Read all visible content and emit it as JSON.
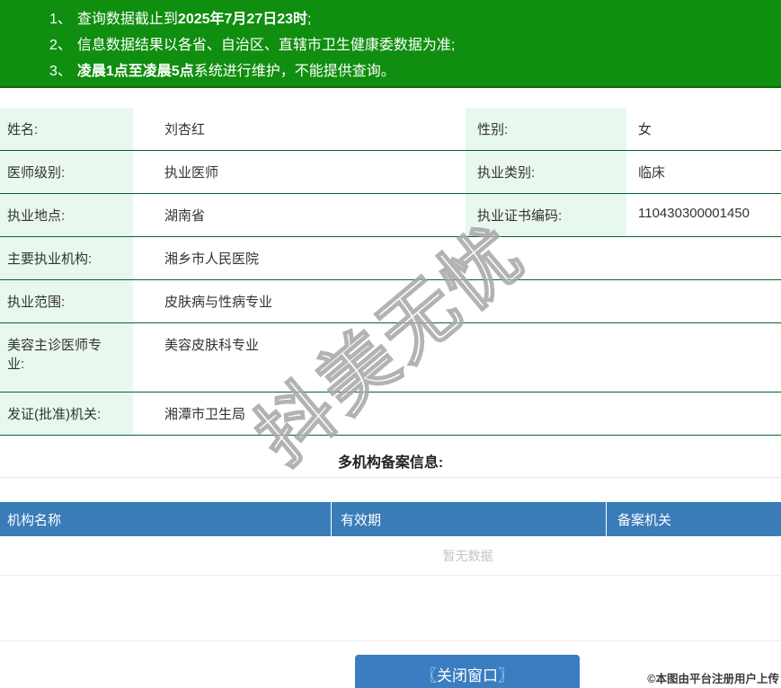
{
  "banner": {
    "notices": [
      {
        "num": "1、",
        "pre": "查询数据截止到",
        "bold": "2025年7月27日23时",
        "post": ";"
      },
      {
        "num": "2、",
        "pre": "信息数据结果以各省、自治区、直辖市卫生健康委数据为准;",
        "bold": "",
        "post": ""
      },
      {
        "num": "3、",
        "pre": "",
        "bold": "凌晨1点至凌晨5点",
        "post": "系统进行维护，不能提供查询。"
      }
    ]
  },
  "profile": {
    "rows": [
      {
        "label": "姓名:",
        "value": "刘杏红",
        "label2": "性别:",
        "value2": "女"
      },
      {
        "label": "医师级别:",
        "value": "执业医师",
        "label2": "执业类别:",
        "value2": "临床"
      },
      {
        "label": "执业地点:",
        "value": "湖南省",
        "label2": "执业证书编码:",
        "value2": "110430300001450"
      },
      {
        "label": "主要执业机构:",
        "value": "湘乡市人民医院"
      },
      {
        "label": "执业范围:",
        "value": "皮肤病与性病专业"
      },
      {
        "label": "美容主诊医师专\n业:",
        "value": "美容皮肤科专业"
      },
      {
        "label": "发证(批准)机关:",
        "value": "湘潭市卫生局"
      }
    ]
  },
  "multi_org": {
    "title": "多机构备案信息:",
    "columns": [
      "机构名称",
      "有效期",
      "备案机关"
    ],
    "empty_text": "暂无数据"
  },
  "footer": {
    "close_button": "〖关闭窗口〗",
    "copyright": "©本图由平台注册用户上传"
  },
  "watermark": "抖美无忧",
  "colors": {
    "banner_bg": "#0f8e0f",
    "banner_border": "#0a6b0a",
    "row_divider": "#006633",
    "label_bg": "#e9f8ef",
    "table_header_bg": "#3a7cb8",
    "button_bg": "#3a7dc1",
    "empty_text": "#c0c4cc"
  }
}
